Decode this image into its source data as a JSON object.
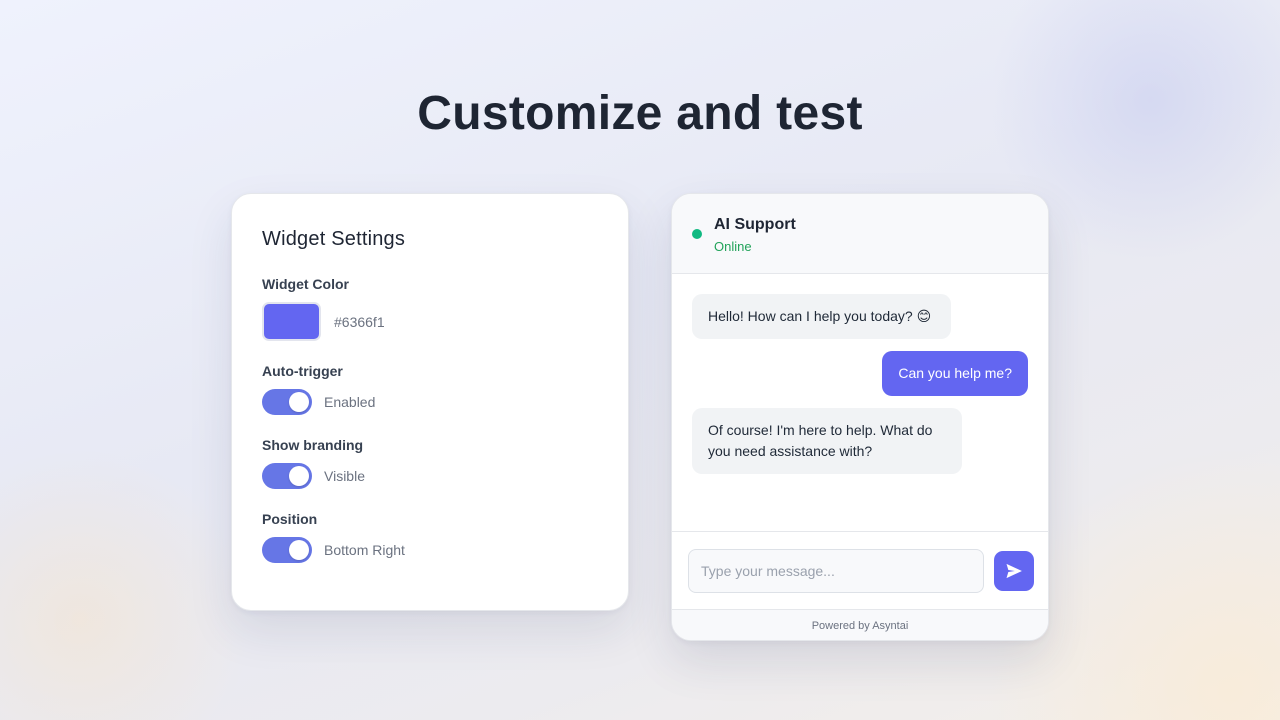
{
  "page": {
    "title": "Customize and test"
  },
  "settings": {
    "title": "Widget Settings",
    "widget_color": {
      "label": "Widget Color",
      "value": "#6366f1"
    },
    "auto_trigger": {
      "label": "Auto-trigger",
      "state_text": "Enabled",
      "on": true
    },
    "show_branding": {
      "label": "Show branding",
      "state_text": "Visible",
      "on": true
    },
    "position": {
      "label": "Position",
      "state_text": "Bottom Right",
      "on": true
    }
  },
  "chat": {
    "name": "AI Support",
    "status": "Online",
    "status_color": "#10b981",
    "messages": [
      {
        "role": "bot",
        "text": "Hello! How can I help you today? 😊"
      },
      {
        "role": "user",
        "text": "Can you help me?"
      },
      {
        "role": "bot",
        "text": "Of course! I'm here to help. What do you need assistance with?"
      }
    ],
    "input": {
      "value": "",
      "placeholder": "Type your message..."
    },
    "send_icon": "send-icon",
    "footer": "Powered by Asyntai"
  },
  "colors": {
    "accent": "#6366f1",
    "toggle": "#6676e6",
    "online": "#10b981"
  }
}
